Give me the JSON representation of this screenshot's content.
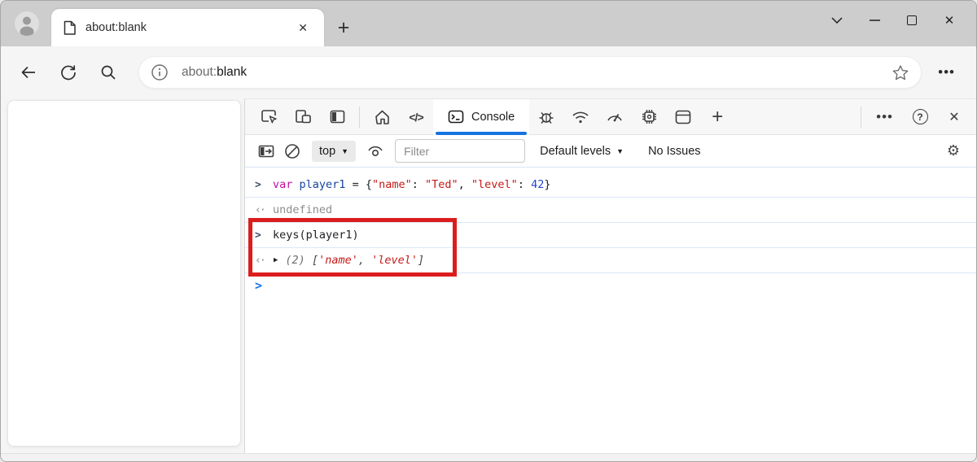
{
  "tabstrip": {
    "tab_title": "about:blank",
    "close_tab_glyph": "✕",
    "new_tab_glyph": "+",
    "window_close_glyph": "✕"
  },
  "navbar": {
    "url_scheme": "about:",
    "url_host": "blank",
    "more_glyph": "•••"
  },
  "devtools": {
    "toolbar": {
      "elements_glyph": "</>",
      "console_tab_label": "Console",
      "more_tools_glyph": "+",
      "more_glyph": "•••",
      "help_glyph": "?",
      "close_glyph": "✕"
    },
    "console_toolbar": {
      "context_label": "top",
      "caret_glyph": "▼",
      "filter_placeholder": "Filter",
      "levels_label": "Default levels",
      "issues_label": "No Issues",
      "gear_glyph": "⚙"
    },
    "console": {
      "glyphs": {
        "command": ">",
        "result": "‹·",
        "expander": "▶",
        "prompt": ">"
      },
      "rows": [
        {
          "kind": "command",
          "tokens": [
            [
              "var",
              "keyword"
            ],
            [
              " ",
              "plain"
            ],
            [
              "player1",
              "variable"
            ],
            [
              " = {",
              "plain"
            ],
            [
              "\"name\"",
              "string"
            ],
            [
              ": ",
              "plain"
            ],
            [
              "\"Ted\"",
              "string"
            ],
            [
              ", ",
              "plain"
            ],
            [
              "\"level\"",
              "string"
            ],
            [
              ": ",
              "plain"
            ],
            [
              "42",
              "number"
            ],
            [
              "}",
              "plain"
            ]
          ]
        },
        {
          "kind": "result-muted",
          "tokens": [
            [
              "undefined",
              "muted"
            ]
          ]
        },
        {
          "kind": "command",
          "tokens": [
            [
              "keys(player1)",
              "plain"
            ]
          ]
        },
        {
          "kind": "result",
          "expander": true,
          "tokens": [
            [
              "(2) ",
              "meta"
            ],
            [
              "[",
              "plain2"
            ],
            [
              "'name'",
              "string2"
            ],
            [
              ", ",
              "plain2"
            ],
            [
              "'level'",
              "string2"
            ],
            [
              "]",
              "plain2"
            ]
          ]
        },
        {
          "kind": "prompt",
          "tokens": []
        }
      ]
    }
  },
  "colors": {
    "accent_blue": "#1673e2",
    "annotation_red": "#dc1d1d",
    "prompt_blue": "#1a73e8"
  }
}
